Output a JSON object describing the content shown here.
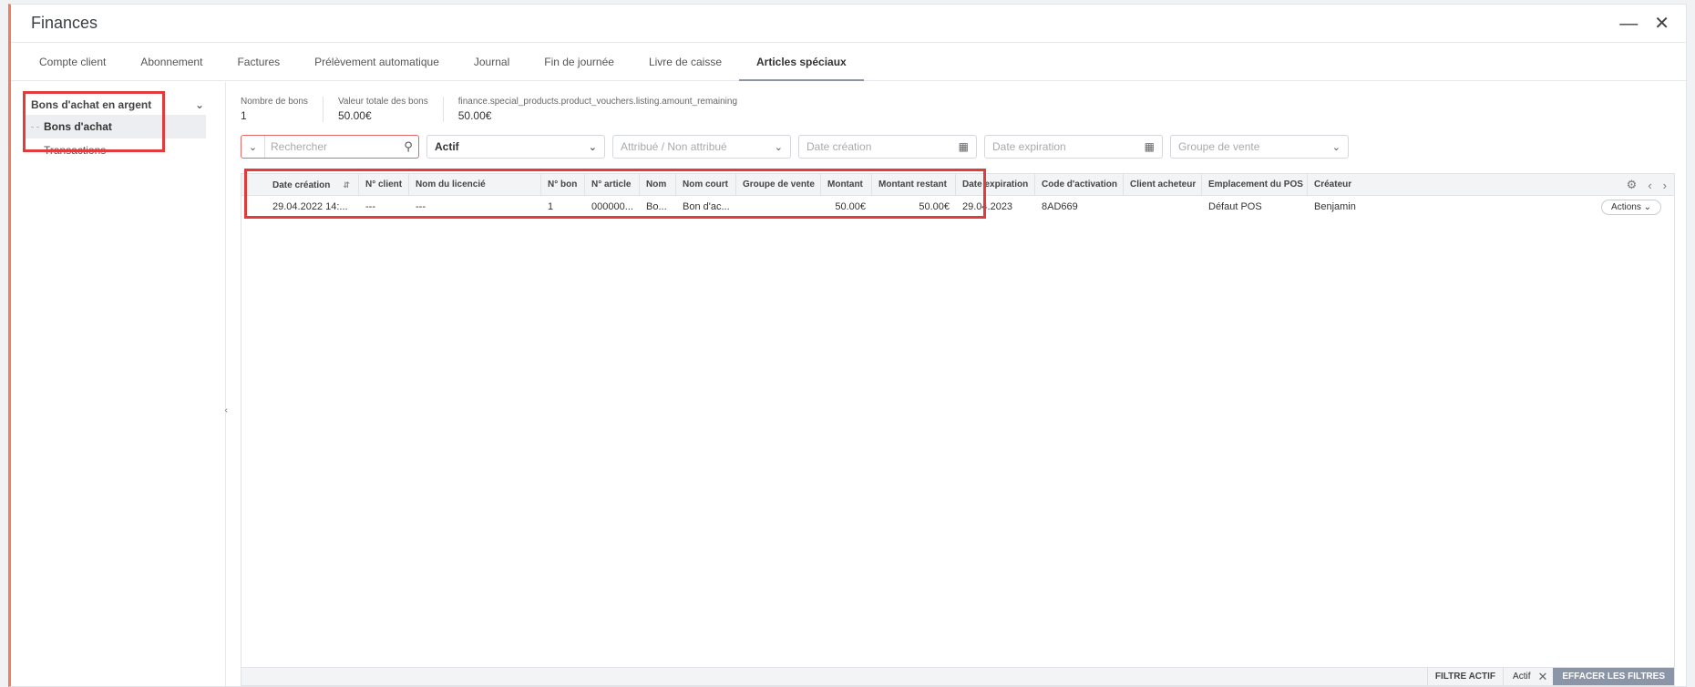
{
  "window": {
    "title": "Finances"
  },
  "tabs": [
    {
      "label": "Compte client"
    },
    {
      "label": "Abonnement"
    },
    {
      "label": "Factures"
    },
    {
      "label": "Prélèvement automatique"
    },
    {
      "label": "Journal"
    },
    {
      "label": "Fin de journée"
    },
    {
      "label": "Livre de caisse"
    },
    {
      "label": "Articles spéciaux",
      "active": true
    }
  ],
  "sidebar": {
    "group_label": "Bons d'achat en argent",
    "items": [
      {
        "label": "Bons d'achat",
        "active": true
      },
      {
        "label": "Transactions"
      }
    ]
  },
  "stats": [
    {
      "label": "Nombre de bons",
      "value": "1"
    },
    {
      "label": "Valeur totale des bons",
      "value": "50.00€"
    },
    {
      "label": "finance.special_products.product_vouchers.listing.amount_remaining",
      "value": "50.00€"
    }
  ],
  "filters": {
    "search_placeholder": "Rechercher",
    "status_value": "Actif",
    "assigned_placeholder": "Attribué / Non attribué",
    "created_placeholder": "Date création",
    "expiry_placeholder": "Date expiration",
    "sales_group_placeholder": "Groupe de vente"
  },
  "table": {
    "columns": [
      "Date création",
      "N° client",
      "Nom du licencié",
      "N° bon",
      "N° article",
      "Nom",
      "Nom court",
      "Groupe de vente",
      "Montant",
      "Montant restant",
      "Date expiration",
      "Code d'activation",
      "Client acheteur",
      "Emplacement du POS",
      "Créateur"
    ],
    "rows": [
      [
        "29.04.2022 14:...",
        "---",
        "---",
        "1",
        "000000...",
        "Bo...",
        "Bon d'ac...",
        "",
        "50.00€",
        "50.00€",
        "29.04.2023",
        "8AD669",
        "",
        "Défaut POS",
        "Benjamin"
      ]
    ],
    "row_action_label": "Actions"
  },
  "footer": {
    "active_filter_label": "FILTRE ACTIF",
    "active_filter_value": "Actif",
    "clear_label": "EFFACER LES FILTRES"
  },
  "colors": {
    "accent": "#f07d5c",
    "highlight": "#e23b3b",
    "clear_button": "#8b95a8"
  }
}
